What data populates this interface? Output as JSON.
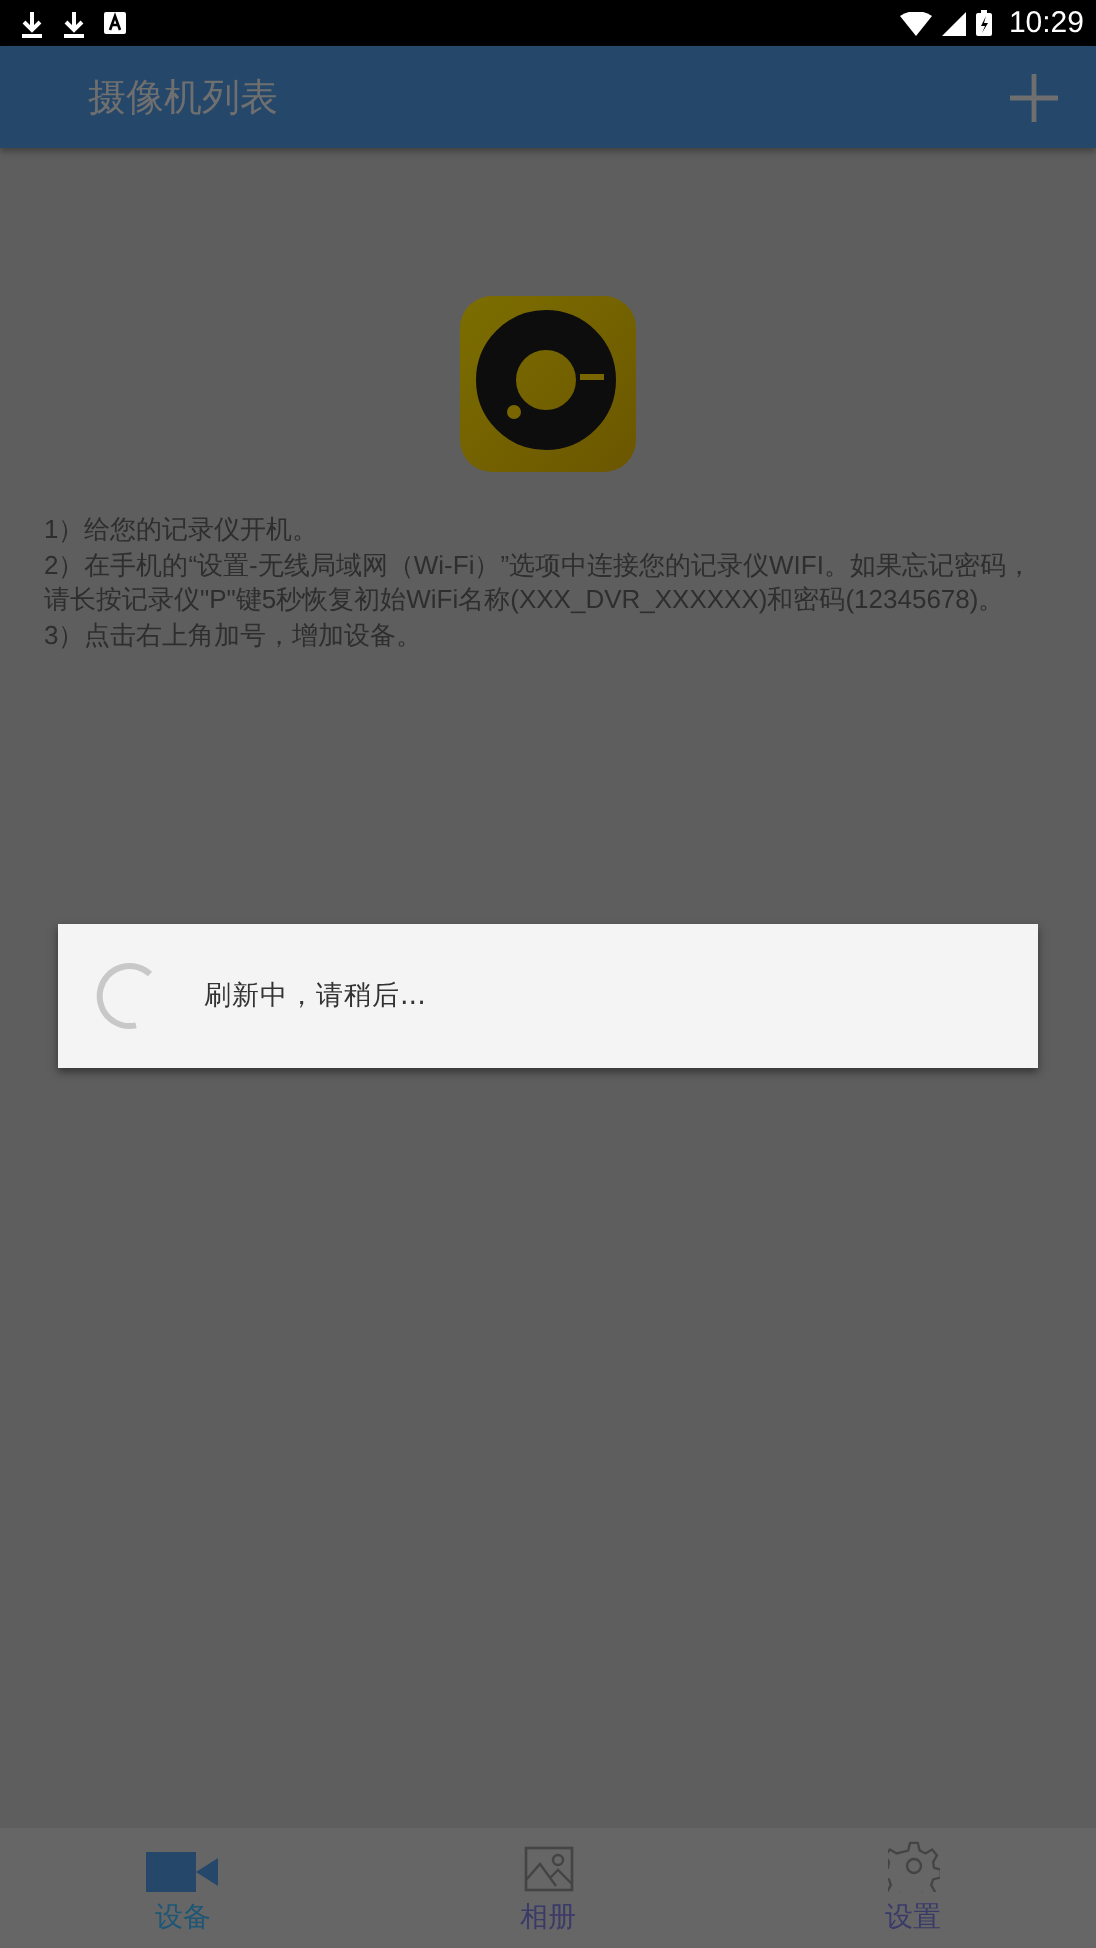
{
  "status_bar": {
    "time": "10:29"
  },
  "app_bar": {
    "title": "摄像机列表"
  },
  "instructions": [
    "1）给您的记录仪开机。",
    "2）在手机的“设置-无线局域网（Wi-Fi）”选项中连接您的记录仪WIFI。如果忘记密码，请长按记录仪\"P\"键5秒恢复初始WiFi名称(XXX_DVR_XXXXXX)和密码(12345678)。",
    "3）点击右上角加号，增加设备。"
  ],
  "dialog": {
    "message": "刷新中，请稍后..."
  },
  "tabs": [
    {
      "label": "设备",
      "kind": "camera",
      "selected": true
    },
    {
      "label": "相册",
      "kind": "photo",
      "selected": false
    },
    {
      "label": "设置",
      "kind": "gear",
      "selected": false
    }
  ]
}
